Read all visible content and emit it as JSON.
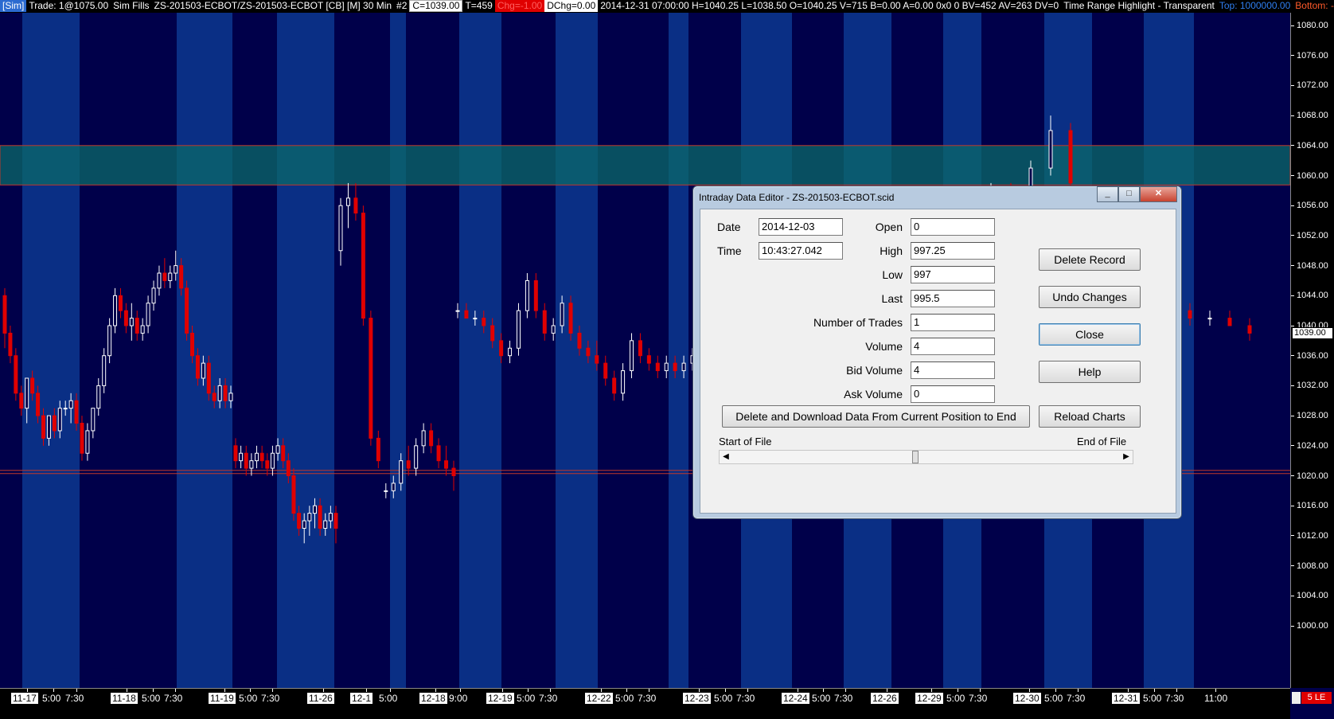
{
  "topbar": {
    "sim": "[Sim]",
    "trade": "Trade: 1@1075.00",
    "fills": "Sim Fills",
    "symbol": "ZS-201503-ECBOT/ZS-201503-ECBOT [CB] [M]  30 Min",
    "chart_num": "#2",
    "close": "C=1039.00",
    "ticks": "T=459",
    "change": "Chg=-1.00",
    "dchange": "DChg=0.00",
    "bar_info": "2014-12-31 07:00:00 H=1040.25 L=1038.50 O=1040.25 V=715 B=0.00 A=0.00 0x0 0 BV=452 AV=263 DV=0",
    "study": "Time Range Highlight - Transparent",
    "top": "Top: 1000000.00",
    "bottom": "Bottom: -100000"
  },
  "price_axis": {
    "ticks": [
      "1080.00",
      "1076.00",
      "1072.00",
      "1068.00",
      "1064.00",
      "1060.00",
      "1056.00",
      "1052.00",
      "1048.00",
      "1044.00",
      "1040.00",
      "1036.00",
      "1032.00",
      "1028.00",
      "1024.00",
      "1020.00",
      "1016.00",
      "1012.00",
      "1008.00",
      "1004.00",
      "1000.00"
    ],
    "current": "1039.00"
  },
  "time_axis": {
    "labels": [
      {
        "text": "11-17",
        "day": true
      },
      {
        "text": "5:00",
        "day": false
      },
      {
        "text": "7:30",
        "day": false
      },
      {
        "text": "11-18",
        "day": true
      },
      {
        "text": "5:00",
        "day": false
      },
      {
        "text": "7:30",
        "day": false
      },
      {
        "text": "11-19",
        "day": true
      },
      {
        "text": "5:00",
        "day": false
      },
      {
        "text": "7:30",
        "day": false
      },
      {
        "text": "11-26",
        "day": true
      },
      {
        "text": "12-1",
        "day": true
      },
      {
        "text": "5:00",
        "day": false
      },
      {
        "text": "12-18",
        "day": true
      },
      {
        "text": "9:00",
        "day": false
      },
      {
        "text": "12-19",
        "day": true
      },
      {
        "text": "5:00",
        "day": false
      },
      {
        "text": "7:30",
        "day": false
      },
      {
        "text": "12-22",
        "day": true
      },
      {
        "text": "5:00",
        "day": false
      },
      {
        "text": "7:30",
        "day": false
      },
      {
        "text": "12-23",
        "day": true
      },
      {
        "text": "5:00",
        "day": false
      },
      {
        "text": "7:30",
        "day": false
      },
      {
        "text": "12-24",
        "day": true
      },
      {
        "text": "5:00",
        "day": false
      },
      {
        "text": "7:30",
        "day": false
      },
      {
        "text": "12-26",
        "day": true
      },
      {
        "text": "12-29",
        "day": true
      },
      {
        "text": "5:00",
        "day": false
      },
      {
        "text": "7:30",
        "day": false
      },
      {
        "text": "12-30",
        "day": true
      },
      {
        "text": "5:00",
        "day": false
      },
      {
        "text": "7:30",
        "day": false
      },
      {
        "text": "12-31",
        "day": true
      },
      {
        "text": "5:00",
        "day": false
      },
      {
        "text": "7:30",
        "day": false
      },
      {
        "text": "11:00",
        "day": false
      }
    ],
    "status": "5 LE"
  },
  "highlight_zones": {
    "upper": {
      "top": 1064.0,
      "bottom": 1058.75
    },
    "lower_line": 1020.5
  },
  "candles": [
    [
      1044,
      1045,
      1037,
      1039
    ],
    [
      1039,
      1040,
      1035,
      1036
    ],
    [
      1036,
      1037,
      1030,
      1031
    ],
    [
      1031,
      1032,
      1028,
      1029
    ],
    [
      1029,
      1033,
      1027,
      1033
    ],
    [
      1033,
      1034,
      1030,
      1031
    ],
    [
      1031,
      1032,
      1027,
      1028
    ],
    [
      1028,
      1029,
      1024,
      1025
    ],
    [
      1025,
      1028,
      1024,
      1028
    ],
    [
      1028,
      1029,
      1025,
      1026
    ],
    [
      1026,
      1030,
      1025,
      1029
    ],
    [
      1029,
      1030,
      1028,
      1029
    ],
    [
      1029,
      1031,
      1027,
      1030
    ],
    [
      1030,
      1031,
      1026,
      1027
    ],
    [
      1027,
      1028,
      1022,
      1023
    ],
    [
      1023,
      1027,
      1022,
      1026
    ],
    [
      1026,
      1029,
      1025,
      1029
    ],
    [
      1029,
      1033,
      1028,
      1032
    ],
    [
      1032,
      1037,
      1031,
      1036
    ],
    [
      1036,
      1041,
      1035,
      1040
    ],
    [
      1040,
      1045,
      1039,
      1044
    ],
    [
      1044,
      1045,
      1041,
      1042
    ],
    [
      1042,
      1043,
      1039,
      1040
    ],
    [
      1040,
      1043,
      1038,
      1041
    ],
    [
      1041,
      1042,
      1038,
      1039
    ],
    [
      1039,
      1041,
      1038,
      1040
    ],
    [
      1040,
      1044,
      1039,
      1043
    ],
    [
      1043,
      1046,
      1042,
      1045
    ],
    [
      1045,
      1048,
      1044,
      1047
    ],
    [
      1047,
      1049,
      1045,
      1046
    ],
    [
      1046,
      1048,
      1045,
      1047
    ],
    [
      1047,
      1050,
      1046,
      1048
    ],
    [
      1048,
      1049,
      1044,
      1045
    ],
    [
      1045,
      1046,
      1038,
      1039
    ],
    [
      1039,
      1040,
      1035,
      1036
    ],
    [
      1036,
      1037,
      1032,
      1033
    ],
    [
      1033,
      1036,
      1032,
      1035
    ],
    [
      1035,
      1036,
      1030,
      1031
    ],
    [
      1031,
      1032,
      1029,
      1030
    ],
    [
      1030,
      1033,
      1029,
      1032
    ],
    [
      1032,
      1033,
      1029,
      1030
    ],
    [
      1030,
      1032,
      1029,
      1031
    ],
    [
      1024,
      1025,
      1021,
      1022
    ],
    [
      1022,
      1024,
      1021,
      1023
    ],
    [
      1023,
      1024,
      1020,
      1021
    ],
    [
      1021,
      1023,
      1020,
      1022
    ],
    [
      1022,
      1024,
      1021,
      1023
    ],
    [
      1023,
      1024,
      1021,
      1022
    ],
    [
      1022,
      1023,
      1020,
      1021
    ],
    [
      1021,
      1024,
      1020,
      1023
    ],
    [
      1023,
      1025,
      1022,
      1024
    ],
    [
      1024,
      1025,
      1021,
      1022
    ],
    [
      1022,
      1023,
      1019,
      1020
    ],
    [
      1020,
      1021,
      1014,
      1015
    ],
    [
      1015,
      1016,
      1012,
      1013
    ],
    [
      1013,
      1015,
      1011,
      1014
    ],
    [
      1014,
      1016,
      1012,
      1015
    ],
    [
      1015,
      1017,
      1013,
      1016
    ],
    [
      1016,
      1017,
      1012,
      1013
    ],
    [
      1013,
      1015,
      1012,
      1014
    ],
    [
      1014,
      1016,
      1013,
      1015
    ],
    [
      1015,
      1016,
      1011,
      1013
    ],
    [
      1050,
      1057,
      1048,
      1056
    ],
    [
      1056,
      1059,
      1053,
      1057
    ],
    [
      1057,
      1059,
      1054,
      1055
    ],
    [
      1055,
      1056,
      1040,
      1041
    ],
    [
      1041,
      1042,
      1024,
      1025
    ],
    [
      1025,
      1026,
      1021,
      1022
    ],
    [
      1018,
      1019,
      1017,
      1018
    ],
    [
      1018,
      1020,
      1017,
      1019
    ],
    [
      1019,
      1023,
      1018,
      1022
    ],
    [
      1022,
      1024,
      1020,
      1021
    ],
    [
      1021,
      1025,
      1020,
      1024
    ],
    [
      1024,
      1027,
      1023,
      1026
    ],
    [
      1026,
      1027,
      1023,
      1024
    ],
    [
      1024,
      1025,
      1021,
      1022
    ],
    [
      1022,
      1024,
      1020,
      1021
    ],
    [
      1021,
      1022,
      1018,
      1020
    ],
    [
      1042,
      1043,
      1041,
      1042
    ],
    [
      1042,
      1043,
      1041,
      1041
    ],
    [
      1041,
      1042,
      1040,
      1041
    ],
    [
      1041,
      1042,
      1039,
      1040
    ],
    [
      1040,
      1041,
      1037,
      1038
    ],
    [
      1038,
      1039,
      1035,
      1036
    ],
    [
      1036,
      1038,
      1035,
      1037
    ],
    [
      1037,
      1043,
      1036,
      1042
    ],
    [
      1042,
      1047,
      1041,
      1046
    ],
    [
      1046,
      1047,
      1041,
      1042
    ],
    [
      1042,
      1043,
      1038,
      1039
    ],
    [
      1039,
      1041,
      1038,
      1040
    ],
    [
      1040,
      1044,
      1039,
      1043
    ],
    [
      1043,
      1044,
      1038,
      1039
    ],
    [
      1039,
      1040,
      1036,
      1037
    ],
    [
      1037,
      1038,
      1035,
      1036
    ],
    [
      1036,
      1038,
      1034,
      1035
    ],
    [
      1035,
      1036,
      1032,
      1033
    ],
    [
      1033,
      1034,
      1030,
      1031
    ],
    [
      1031,
      1035,
      1030,
      1034
    ],
    [
      1034,
      1039,
      1033,
      1038
    ],
    [
      1038,
      1039,
      1035,
      1036
    ],
    [
      1036,
      1037,
      1034,
      1035
    ],
    [
      1035,
      1036,
      1033,
      1034
    ],
    [
      1034,
      1036,
      1033,
      1035
    ],
    [
      1035,
      1036,
      1033,
      1034
    ],
    [
      1034,
      1036,
      1033,
      1035
    ],
    [
      1035,
      1037,
      1034,
      1036
    ],
    [
      1058,
      1059,
      1057,
      1058
    ],
    [
      1058,
      1059,
      1056,
      1057
    ],
    [
      1057,
      1062,
      1056,
      1061
    ],
    [
      1061,
      1068,
      1060,
      1066
    ],
    [
      1066,
      1067,
      1058,
      1059
    ],
    [
      1055,
      1056,
      1050,
      1051
    ],
    [
      1051,
      1052,
      1045,
      1046
    ],
    [
      1046,
      1047,
      1043,
      1044
    ],
    [
      1044,
      1045,
      1042,
      1043
    ],
    [
      1043,
      1044,
      1041,
      1042
    ],
    [
      1042,
      1043,
      1040,
      1041
    ],
    [
      1041,
      1042,
      1040,
      1041
    ],
    [
      1041,
      1042,
      1040,
      1040
    ],
    [
      1040,
      1041,
      1038,
      1039
    ]
  ],
  "dialog": {
    "title": "Intraday Data Editor - ZS-201503-ECBOT.scid",
    "min_label": "_",
    "max_label": "□",
    "close_label": "✕",
    "date_label": "Date",
    "date_value": "2014-12-03",
    "time_label": "Time",
    "time_value": "10:43:27.042",
    "open_label": "Open",
    "open_value": "0",
    "high_label": "High",
    "high_value": "997.25",
    "low_label": "Low",
    "low_value": "997",
    "last_label": "Last",
    "last_value": "995.5",
    "trades_label": "Number of Trades",
    "trades_value": "1",
    "volume_label": "Volume",
    "volume_value": "4",
    "bidvol_label": "Bid Volume",
    "bidvol_value": "4",
    "askvol_label": "Ask Volume",
    "askvol_value": "0",
    "delete_record": "Delete  Record",
    "undo": "Undo Changes",
    "close": "Close",
    "help": "Help",
    "delete_download": "Delete and Download Data From Current Position to End",
    "reload": "Reload Charts",
    "start_of_file": "Start of File",
    "end_of_file": "End of File",
    "scroll_position": 0.47
  },
  "colors": {
    "band_dark": "#00004a",
    "band_light": "#0a2f85",
    "up": "#ffffff",
    "down": "#e00000",
    "zone_fill": "#0b6a6a"
  }
}
